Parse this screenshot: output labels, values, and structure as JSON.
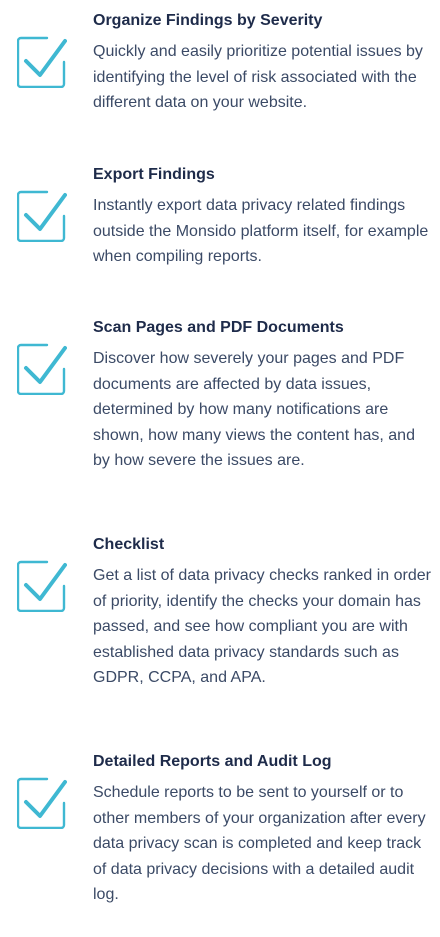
{
  "colors": {
    "check_accent": "#3fb8d2",
    "title_text": "#1e2b4a",
    "body_text": "#3b4a66"
  },
  "features": [
    {
      "icon": "checkbox-checked-icon",
      "title": "Organize Findings by Severity",
      "description": "Quickly and easily prioritize potential issues by identifying the level of risk associated with the different data on your website."
    },
    {
      "icon": "checkbox-checked-icon",
      "title": "Export Findings",
      "description": "Instantly export data privacy related findings outside the Monsido platform itself, for example when compiling reports."
    },
    {
      "icon": "checkbox-checked-icon",
      "title": "Scan Pages and PDF Documents",
      "description": "Discover how severely your pages and PDF documents are affected by data issues, determined by how many notifications are shown, how many views the content has, and by how severe the issues are."
    },
    {
      "icon": "checkbox-checked-icon",
      "title": "Checklist",
      "description": "Get a list of data privacy checks ranked in order of priority, identify the checks your domain has passed, and see how compliant you are with established data privacy standards such as GDPR, CCPA, and APA."
    },
    {
      "icon": "checkbox-checked-icon",
      "title": "Detailed Reports and Audit Log",
      "description": "Schedule reports to be sent to yourself or to other members of your organization after every data privacy scan is completed and keep track of data privacy decisions with a detailed audit log."
    }
  ]
}
